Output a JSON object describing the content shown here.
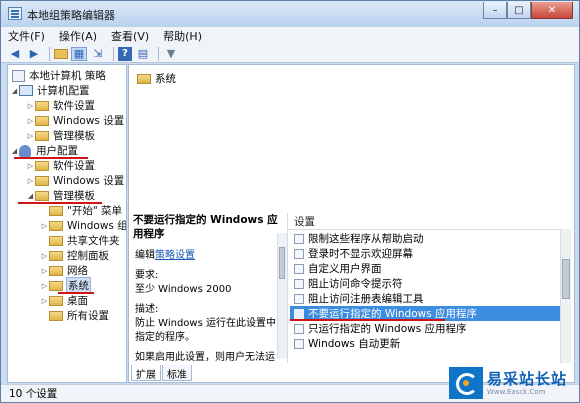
{
  "window": {
    "title": "本地组策略编辑器",
    "controls": {
      "minimize": "–",
      "maximize": "□",
      "close": "✕"
    }
  },
  "menubar": [
    "文件(F)",
    "操作(A)",
    "查看(V)",
    "帮助(H)"
  ],
  "toolbar": {
    "icons": [
      "back-icon",
      "forward-icon",
      "up-folder-icon",
      "show-hide-tree-icon",
      "export-icon",
      "help-icon",
      "properties-icon",
      "filter-icon"
    ]
  },
  "tree": {
    "root": "本地计算机 策略",
    "computer_config": "计算机配置",
    "computer_children": [
      "软件设置",
      "Windows 设置",
      "管理模板"
    ],
    "user_config": "用户配置",
    "user_children": [
      "软件设置",
      "Windows 设置",
      "管理模板"
    ],
    "admin_children": [
      "\"开始\" 菜单",
      "Windows 组",
      "共享文件夹",
      "控制面板",
      "网络",
      "系统",
      "桌面",
      "所有设置"
    ]
  },
  "right": {
    "header_folder": "系统",
    "desc_title": "不要运行指定的 Windows 应用程序",
    "edit_prefix": "编辑",
    "edit_link": "策略设置",
    "req_label": "要求:",
    "req_value": "至少 Windows 2000",
    "desc_label": "描述:",
    "desc_text": "防止 Windows 运行在此设置中指定的程序。",
    "desc_more": "如果启用此设置，则用户无法运行",
    "list_header": "设置",
    "list": [
      "限制这些程序从帮助启动",
      "登录时不显示欢迎屏幕",
      "自定义用户界面",
      "阻止访问命令提示符",
      "阻止访问注册表编辑工具",
      "不要运行指定的 Windows 应用程序",
      "只运行指定的 Windows 应用程序",
      "Windows 自动更新"
    ],
    "selected_index": 5,
    "tabs": [
      "扩展",
      "标准"
    ]
  },
  "status": "10 个设置",
  "brand": {
    "name": "易采站长站",
    "url": "Www.Easck.Com"
  },
  "colors": {
    "accent": "#3c8ce0",
    "annotation_red": "#d01414",
    "window_frame": "#c9dcf2"
  }
}
